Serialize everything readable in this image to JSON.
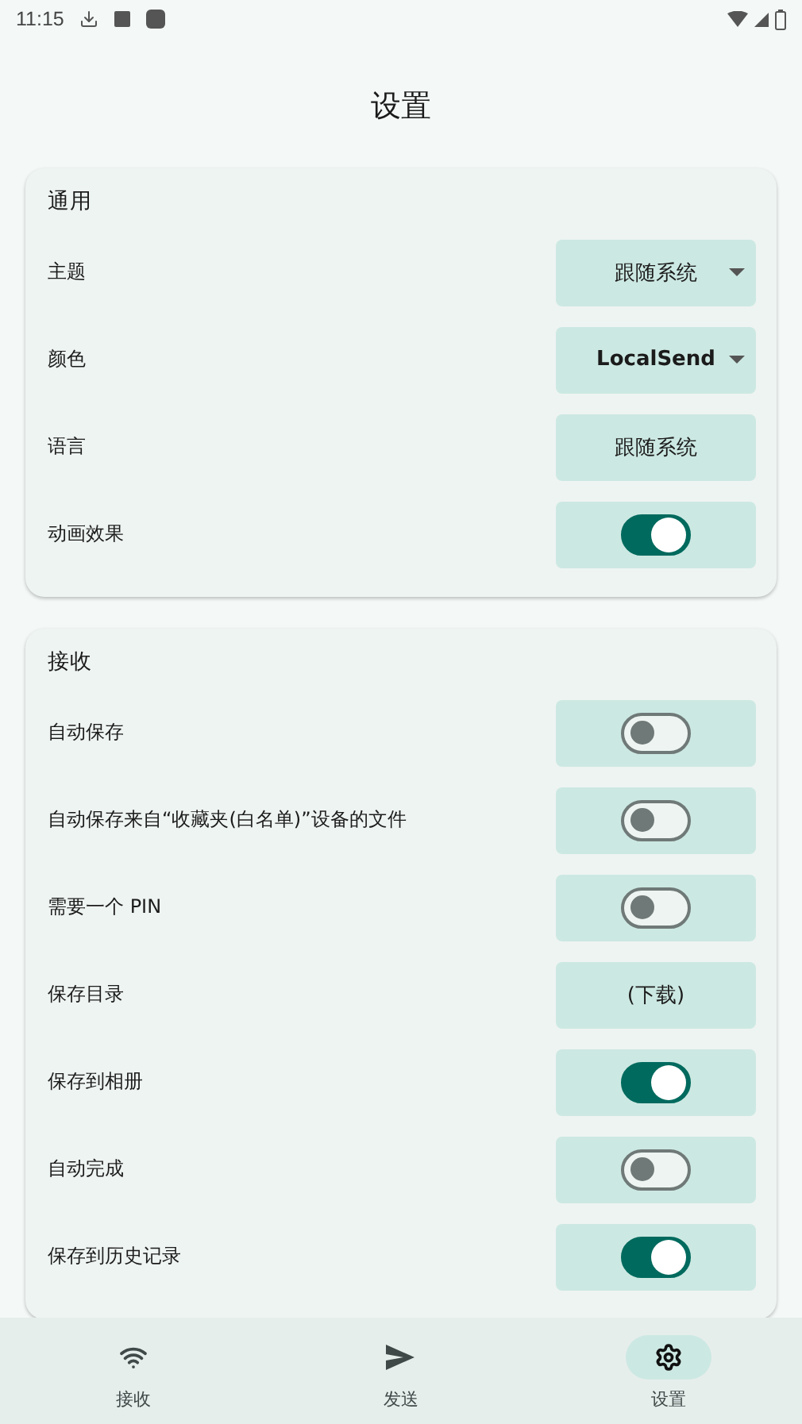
{
  "status_bar": {
    "time": "11:15"
  },
  "title": "设置",
  "sections": [
    {
      "heading": "通用",
      "rows": [
        {
          "label": "主题",
          "kind": "dropdown",
          "value": "跟随系统",
          "bold": false
        },
        {
          "label": "颜色",
          "kind": "dropdown",
          "value": "LocalSend",
          "bold": true
        },
        {
          "label": "语言",
          "kind": "button",
          "value": "跟随系统"
        },
        {
          "label": "动画效果",
          "kind": "switch",
          "on": true
        }
      ]
    },
    {
      "heading": "接收",
      "rows": [
        {
          "label": "自动保存",
          "kind": "switch",
          "on": false
        },
        {
          "label": "自动保存来自“收藏夹(白名单)”设备的文件",
          "kind": "switch",
          "on": false
        },
        {
          "label": "需要一个 PIN",
          "kind": "switch",
          "on": false
        },
        {
          "label": "保存目录",
          "kind": "button",
          "value": "(下载)"
        },
        {
          "label": "保存到相册",
          "kind": "switch",
          "on": true
        },
        {
          "label": "自动完成",
          "kind": "switch",
          "on": false
        },
        {
          "label": "保存到历史记录",
          "kind": "switch",
          "on": true
        }
      ]
    }
  ],
  "nav": [
    {
      "label": "接收",
      "selected": false
    },
    {
      "label": "发送",
      "selected": false
    },
    {
      "label": "设置",
      "selected": true
    }
  ]
}
